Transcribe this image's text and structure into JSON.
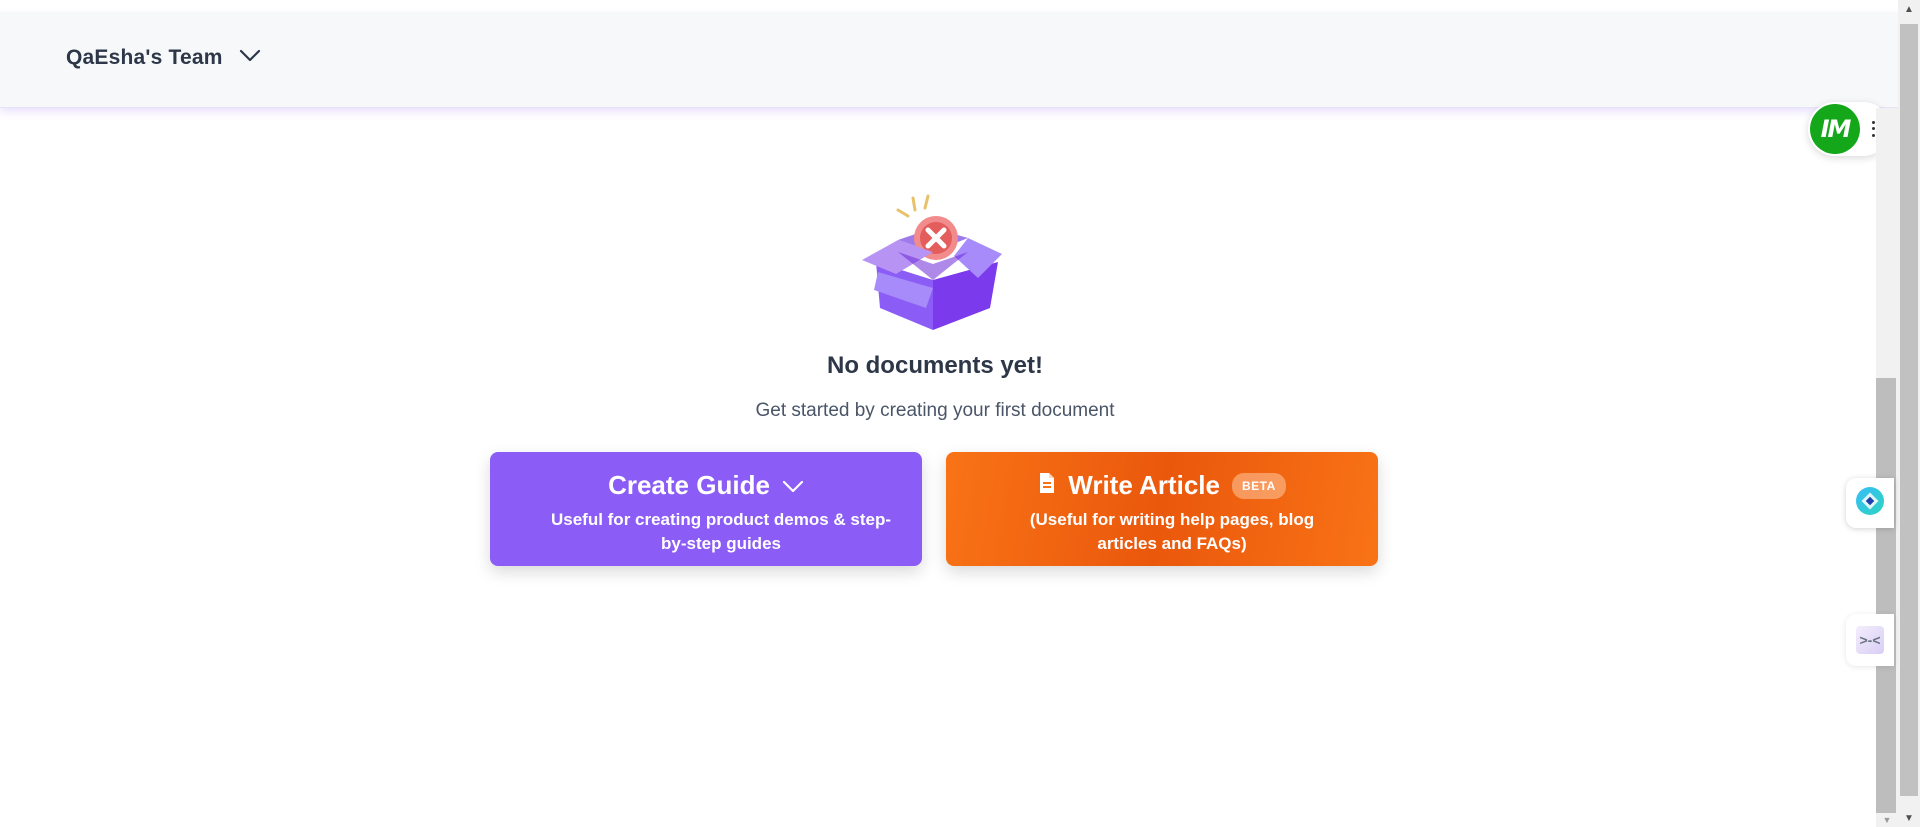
{
  "header": {
    "team_name": "QaEsha's Team"
  },
  "avatar_widget": {
    "initials": "IM",
    "color": "#14a71a"
  },
  "empty_state": {
    "title": "No documents yet!",
    "subtitle": "Get started by creating your first document"
  },
  "actions": {
    "create_guide": {
      "label": "Create Guide",
      "description": "Useful for creating product demos & step-by-step guides",
      "color": "#8b5cf6"
    },
    "write_article": {
      "label": "Write Article",
      "badge": "BETA",
      "description": "(Useful for writing help pages, blog articles and FAQs)",
      "color": "#f97316"
    }
  },
  "side_widgets": {
    "collapse_glyph": ">-<"
  },
  "icons": {
    "team_chevron": "chevron-down-icon",
    "guide_chevron": "chevron-down-icon",
    "article_icon": "document-icon",
    "illustration": "empty-box-illustration",
    "assistant_icon": "assistant-orb-icon",
    "drag_handle": "drag-handle-icon"
  }
}
